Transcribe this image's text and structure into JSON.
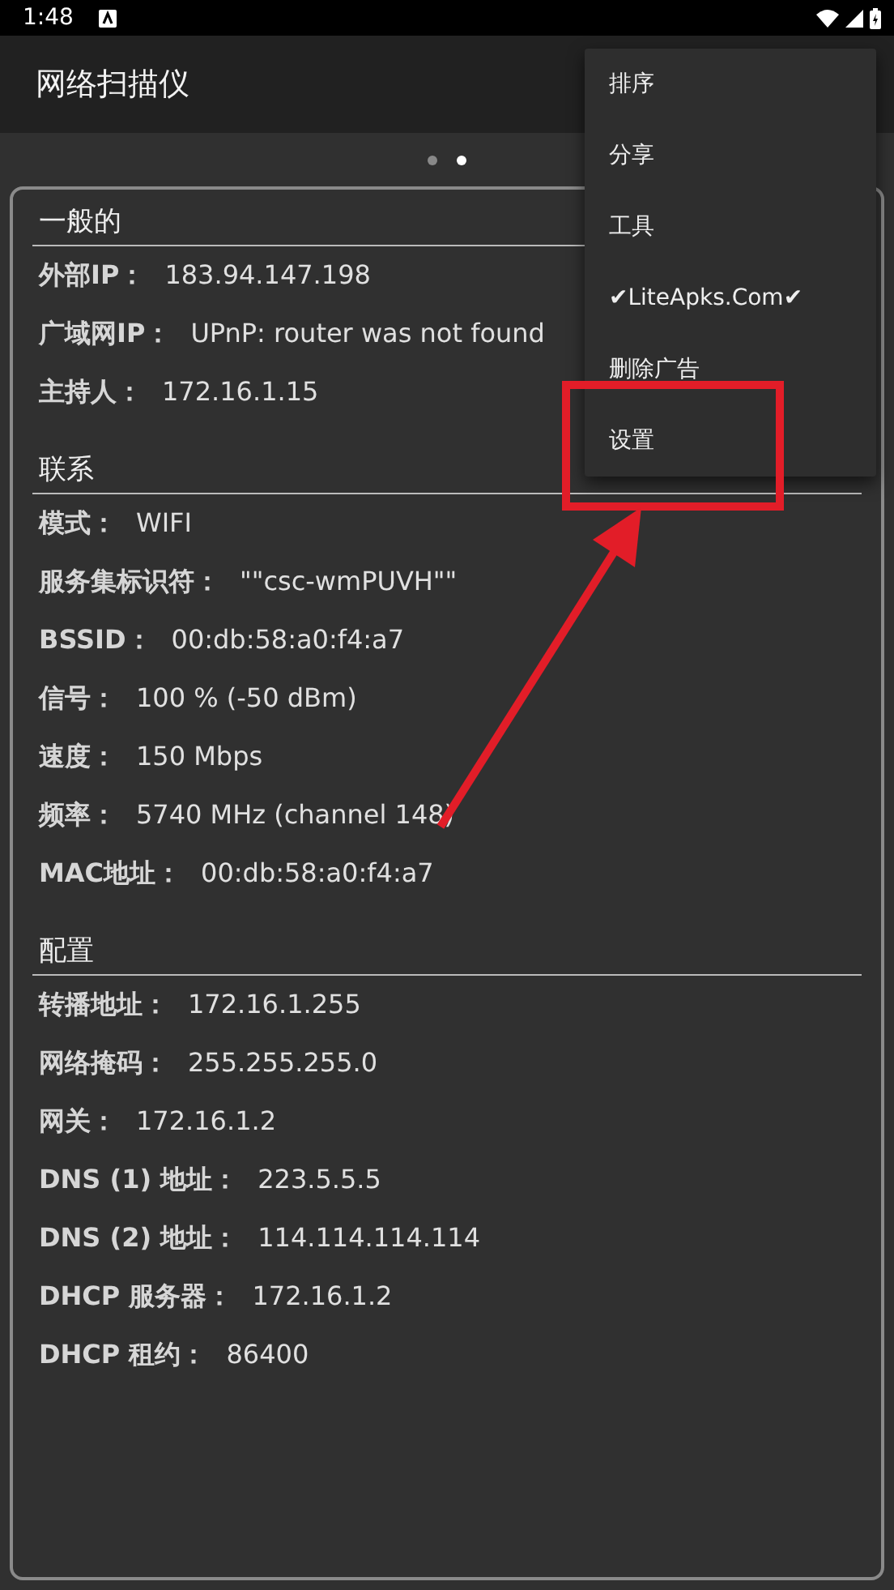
{
  "status_bar": {
    "time": "1:48"
  },
  "app_bar": {
    "title": "网络扫描仪"
  },
  "pager": {
    "dots": [
      {
        "selected": false
      },
      {
        "selected": true
      }
    ]
  },
  "sections": [
    {
      "title": "一般的",
      "rows": [
        {
          "label": "外部IP：",
          "value": "183.94.147.198"
        },
        {
          "label": "广域网IP：",
          "value": "UPnP: router was not found"
        },
        {
          "label": "主持人：",
          "value": "172.16.1.15"
        }
      ]
    },
    {
      "title": "联系",
      "rows": [
        {
          "label": "模式：",
          "value": "WIFI"
        },
        {
          "label": "服务集标识符：",
          "value": "\"\"csc-wmPUVH\"\""
        },
        {
          "label": "BSSID：",
          "value": "00:db:58:a0:f4:a7"
        },
        {
          "label": "信号：",
          "value": "100 % (-50 dBm)"
        },
        {
          "label": "速度：",
          "value": "150 Mbps"
        },
        {
          "label": "频率：",
          "value": "5740 MHz (channel 148)"
        },
        {
          "label": "MAC地址：",
          "value": "00:db:58:a0:f4:a7"
        }
      ]
    },
    {
      "title": "配置",
      "rows": [
        {
          "label": "转播地址：",
          "value": "172.16.1.255"
        },
        {
          "label": "网络掩码：",
          "value": "255.255.255.0"
        },
        {
          "label": "网关：",
          "value": "172.16.1.2"
        },
        {
          "label": "DNS (1) 地址：",
          "value": "223.5.5.5"
        },
        {
          "label": "DNS (2) 地址：",
          "value": "114.114.114.114"
        },
        {
          "label": "DHCP 服务器：",
          "value": "172.16.1.2"
        },
        {
          "label": "DHCP 租约：",
          "value": "86400"
        }
      ]
    }
  ],
  "menu": {
    "items": [
      {
        "label": "排序"
      },
      {
        "label": "分享"
      },
      {
        "label": "工具"
      },
      {
        "label": "✔LiteApks.Com✔"
      },
      {
        "label": "删除广告"
      },
      {
        "label": "设置"
      }
    ]
  }
}
